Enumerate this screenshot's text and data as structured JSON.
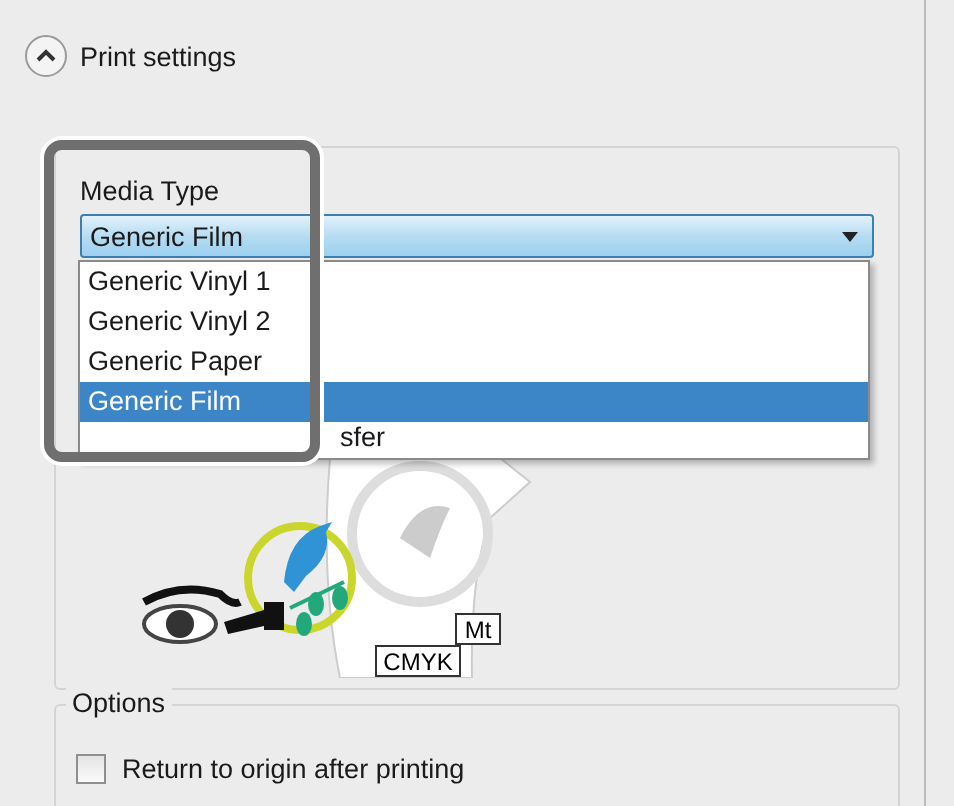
{
  "header": {
    "title": "Print settings",
    "expanded": true
  },
  "media_type": {
    "label": "Media Type",
    "value": "Generic Film",
    "options": [
      {
        "label": "Generic Vinyl 1",
        "selected": false
      },
      {
        "label": "Generic Vinyl 2",
        "selected": false
      },
      {
        "label": "Generic Paper",
        "selected": false
      },
      {
        "label": "Generic Film",
        "selected": true
      },
      {
        "label": "sfer",
        "selected": false,
        "kind": "covered"
      }
    ]
  },
  "preview": {
    "tags": [
      "Mt",
      "CMYK"
    ]
  },
  "options": {
    "title": "Options",
    "items": [
      {
        "label": "Return to origin after printing",
        "checked": false
      }
    ]
  }
}
